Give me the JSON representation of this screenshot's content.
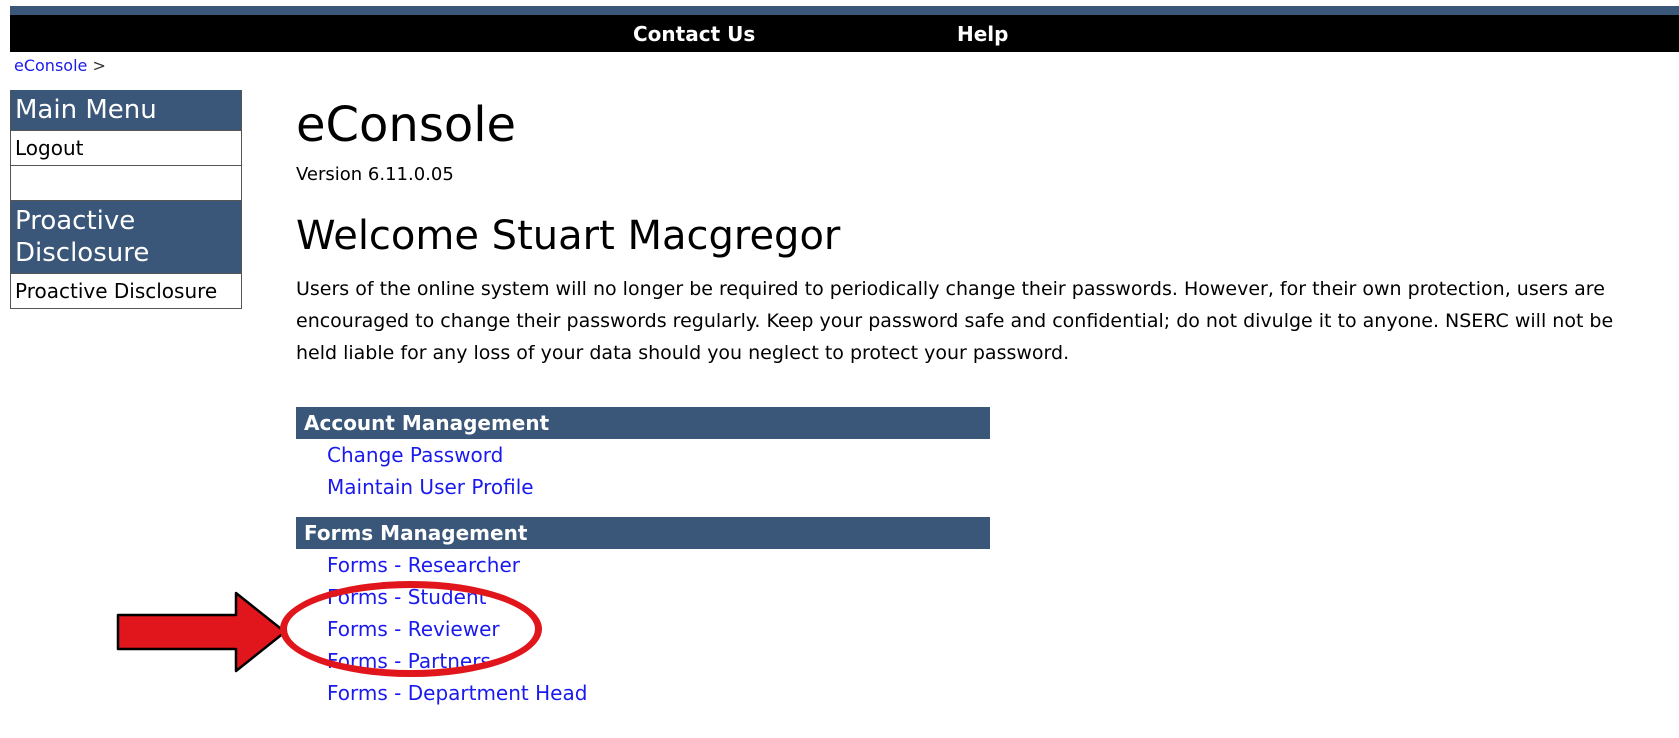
{
  "topbar": {
    "contact_label": "Contact Us",
    "help_label": "Help"
  },
  "breadcrumb": {
    "home_label": "eConsole",
    "separator": ">"
  },
  "sidebar": {
    "main_menu_heading": "Main Menu",
    "logout_label": "Logout",
    "proactive_heading": "Proactive Disclosure",
    "proactive_link_label": "Proactive Disclosure"
  },
  "main": {
    "title": "eConsole",
    "version": "Version 6.11.0.05",
    "welcome": "Welcome Stuart Macgregor",
    "notice": "Users of the online system will no longer be required to periodically change their passwords. However, for their own protection, users are encouraged to change their passwords regularly. Keep your password safe and confidential; do not divulge it to anyone. NSERC will not be held liable for any loss of your data should you neglect to protect your password."
  },
  "account_management": {
    "heading": "Account Management",
    "links": [
      "Change Password",
      "Maintain User Profile"
    ]
  },
  "forms_management": {
    "heading": "Forms Management",
    "links": [
      "Forms - Researcher",
      "Forms - Student",
      "Forms - Reviewer",
      "Forms - Partners",
      "Forms - Department Head"
    ]
  },
  "colors": {
    "header_blue": "#3a5679",
    "link_blue": "#1a1aee",
    "annotation_red": "#e0161c"
  }
}
